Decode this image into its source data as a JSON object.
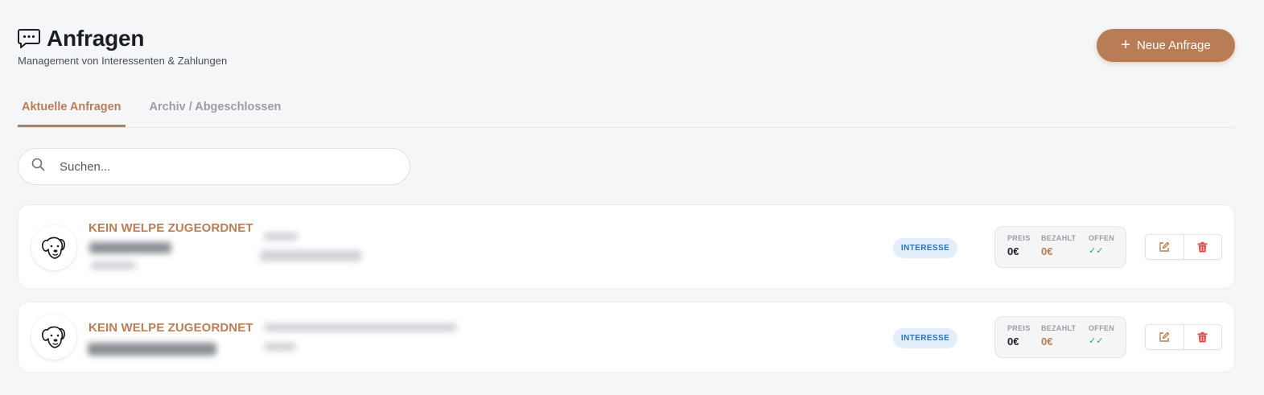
{
  "header": {
    "title": "Anfragen",
    "subtitle": "Management von Interessenten & Zahlungen",
    "icon": "chat-bubble-icon"
  },
  "actions": {
    "new_request_label": "Neue Anfrage"
  },
  "tabs": [
    {
      "label": "Aktuelle Anfragen",
      "active": true
    },
    {
      "label": "Archiv / Abgeschlossen",
      "active": false
    }
  ],
  "search": {
    "placeholder": "Suchen..."
  },
  "requests": [
    {
      "puppy": "KEIN WELPE ZUGEORDNET",
      "status": "INTERESSE",
      "price_label": "PREIS",
      "price": "0€",
      "paid_label": "BEZAHLT",
      "paid": "0€",
      "open_label": "OFFEN",
      "open": "✓✓"
    },
    {
      "puppy": "KEIN WELPE ZUGEORDNET",
      "status": "INTERESSE",
      "price_label": "PREIS",
      "price": "0€",
      "paid_label": "BEZAHLT",
      "paid": "0€",
      "open_label": "OFFEN",
      "open": "✓✓"
    }
  ],
  "colors": {
    "accent": "#b97d56",
    "background": "#f5f6f8",
    "badge_bg": "#e2effb",
    "badge_text": "#2d6fb0",
    "delete": "#e0474c",
    "check": "#3aa65a"
  }
}
